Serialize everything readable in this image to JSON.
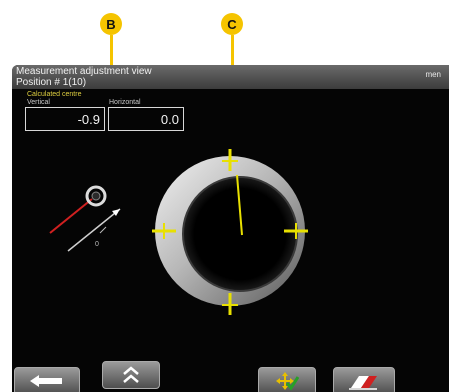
{
  "callouts": {
    "b": "B",
    "c": "C"
  },
  "window": {
    "title": "Measurement adjustment view",
    "subtitle": "Position # 1(10)",
    "menu_label": "men"
  },
  "calculated_centre": {
    "heading": "Calculated centre",
    "vertical_label": "Vertical",
    "vertical_value": "-0.9",
    "horizontal_label": "Horizontal",
    "horizontal_value": "0.0"
  },
  "sensor_diagram": {
    "axis_label": "0"
  },
  "toolbar": {
    "icons": [
      "arrow-left-icon",
      "chevron-double-up-icon",
      "move-check-icon",
      "erase-icon"
    ]
  },
  "colors": {
    "callout": "#f5c400",
    "marker": "#e8e000",
    "screen_background": "#050505",
    "sensor_laser": "#d02020"
  }
}
